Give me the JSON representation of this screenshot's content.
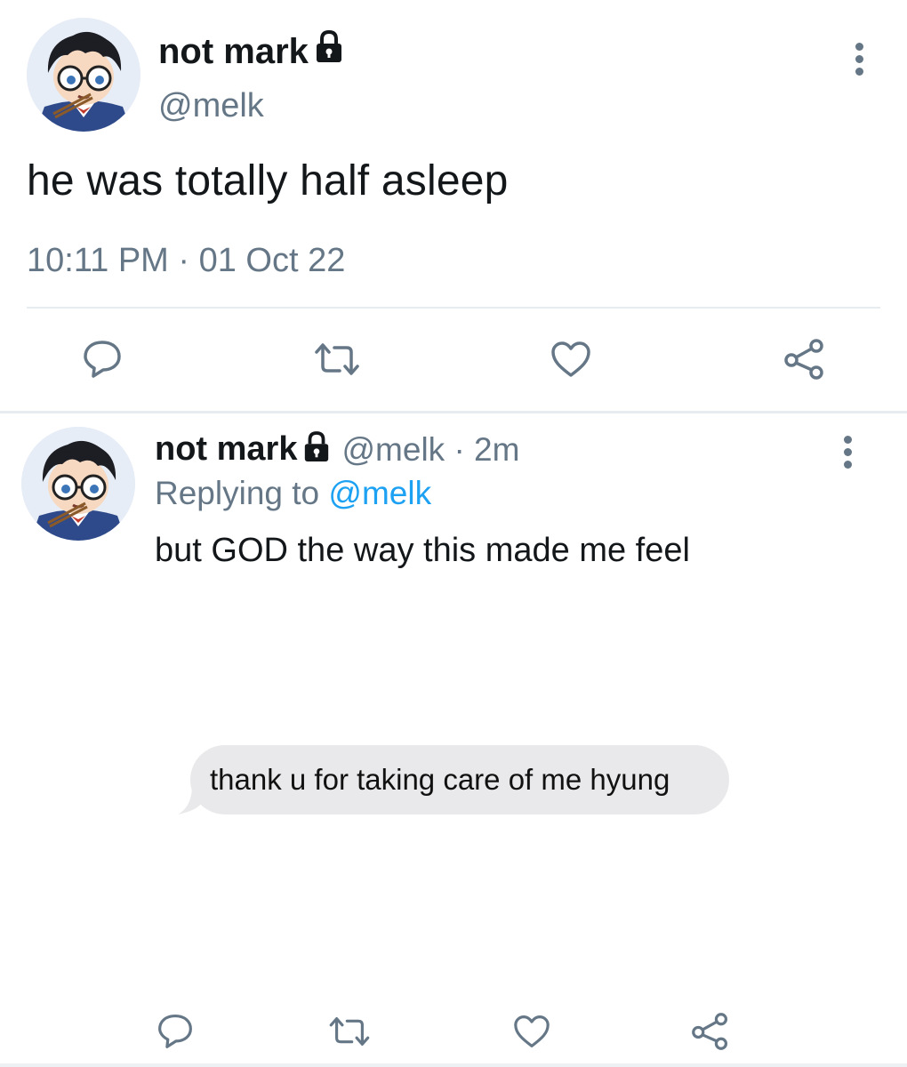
{
  "main_tweet": {
    "display_name": "not mark",
    "handle": "@melk",
    "text": "he was totally half asleep",
    "timestamp": "10:11 PM · 01 Oct 22",
    "icons": [
      "avatar",
      "lock-icon",
      "more-options-icon",
      "reply-icon",
      "retweet-icon",
      "like-icon",
      "share-icon"
    ]
  },
  "reply_tweet": {
    "display_name": "not mark",
    "meta": "@melk · 2m",
    "replying_prefix": "Replying to ",
    "replying_handle": "@melk",
    "text": "but GOD the way this made me feel",
    "attachment": {
      "message_text": "thank u for taking care of me hyung"
    },
    "icons": [
      "avatar",
      "lock-icon",
      "more-options-icon",
      "reply-icon",
      "retweet-icon",
      "like-icon",
      "share-icon"
    ]
  },
  "colors": {
    "text_primary": "#14171a",
    "text_secondary": "#657786",
    "link": "#1da1f2",
    "divider": "#e6ecf0",
    "bubble": "#e9e9eb"
  }
}
